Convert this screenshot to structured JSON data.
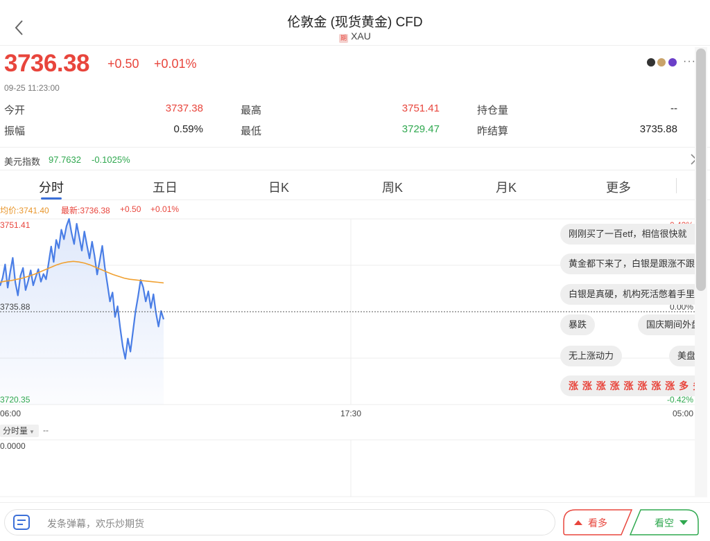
{
  "header": {
    "title": "伦敦金 (现货黄金) CFD",
    "badge": "期",
    "symbol": "XAU"
  },
  "quote": {
    "price": "3736.38",
    "change": "+0.50",
    "change_pct": "+0.01%",
    "timestamp": "09-25 11:23:00",
    "more": "···"
  },
  "stats": {
    "open_label": "今开",
    "open_value": "3737.38",
    "amplitude_label": "振幅",
    "amplitude_value": "0.59%",
    "high_label": "最高",
    "high_value": "3751.41",
    "low_label": "最低",
    "low_value": "3729.47",
    "oi_label": "持仓量",
    "oi_value": "--",
    "settle_label": "昨结算",
    "settle_value": "3735.88"
  },
  "index": {
    "label": "美元指数",
    "value": "97.7632",
    "change": "-0.1025%"
  },
  "tabs": [
    "分时",
    "五日",
    "日K",
    "周K",
    "月K",
    "更多"
  ],
  "info_line": {
    "avg": "均价:3741.40",
    "latest": "最新:3736.38",
    "change": "+0.50",
    "pct": "+0.01%"
  },
  "chart_data": {
    "type": "line",
    "y_labels": {
      "high": "3751.41",
      "mid": "3735.88",
      "low": "3720.35"
    },
    "pct_labels": {
      "high": "0.42%",
      "mid": "0.00%",
      "low": "-0.42%"
    },
    "x_labels": [
      "06:00",
      "17:30",
      "05:00"
    ],
    "ylim": [
      3720.35,
      3751.41
    ],
    "reference": 3735.88,
    "series": [
      {
        "values": [
          3740.2,
          3741.5,
          3743.8,
          3739.9,
          3742.6,
          3744.9,
          3740.8,
          3738.6,
          3741.9,
          3743.2,
          3739.5,
          3741.0,
          3742.8,
          3740.3,
          3741.7,
          3743.0,
          3740.9,
          3742.2,
          3741.3,
          3744.0,
          3746.8,
          3744.2,
          3747.9,
          3746.5,
          3749.6,
          3748.0,
          3750.2,
          3751.41,
          3749.0,
          3747.2,
          3750.6,
          3748.4,
          3746.1,
          3749.3,
          3747.0,
          3744.8,
          3747.6,
          3745.2,
          3742.1,
          3744.4,
          3746.9,
          3743.3,
          3740.5,
          3737.6,
          3739.1,
          3735.0,
          3736.8,
          3733.2,
          3730.1,
          3728.0,
          3731.4,
          3729.2,
          3732.6,
          3735.9,
          3738.4,
          3741.2,
          3740.0,
          3737.6,
          3739.3,
          3736.5,
          3738.8,
          3735.7,
          3733.4,
          3736.0,
          3734.6
        ],
        "avg_values": [
          3740.8,
          3741.0,
          3741.1,
          3741.3,
          3741.5,
          3741.8,
          3742.1,
          3742.5,
          3742.9,
          3743.3,
          3743.7,
          3744.0,
          3744.2,
          3744.3,
          3744.2,
          3744.0,
          3743.7,
          3743.3,
          3742.9,
          3742.5,
          3742.1,
          3741.8,
          3741.5,
          3741.3,
          3741.2,
          3741.1,
          3741.0,
          3740.9,
          3740.8,
          3740.7
        ]
      }
    ]
  },
  "danmaku": [
    "刚刚买了一百etf，相信很快就",
    "黄金都下来了，白银是跟涨不跟",
    "白银是真硬，机构死活憋着手里",
    "暴跌",
    "国庆期间外盘",
    "无上涨动力",
    "美盘已",
    "涨 涨 涨 涨 涨 涨 涨 涨 多 多"
  ],
  "volume": {
    "tag": "分时量",
    "dash": "--",
    "zero": "0.0000"
  },
  "bottom": {
    "input_placeholder": "发条弹幕，欢乐炒期货",
    "bull_label": "看多",
    "bear_label": "看空"
  },
  "colors": {
    "up": "#e8453c",
    "down": "#2fa84f",
    "price_line": "#4a7ee6",
    "avg_line": "#f0a030",
    "accent": "#3b6fd8"
  }
}
